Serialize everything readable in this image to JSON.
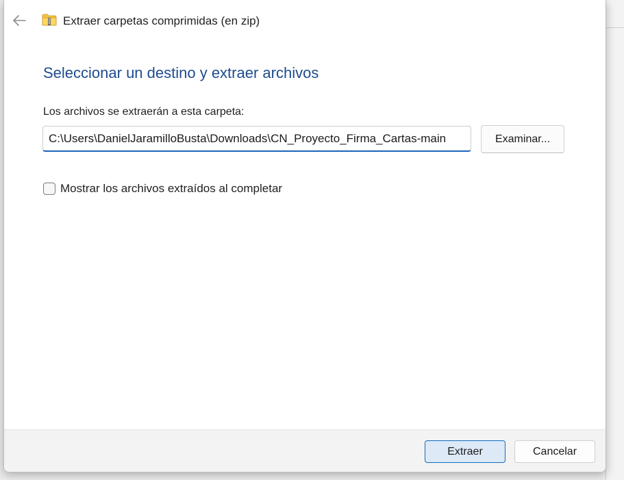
{
  "window": {
    "title": "Extraer carpetas comprimidas (en zip)",
    "back_icon": "arrow-left-icon",
    "app_icon": "zip-folder-icon"
  },
  "main": {
    "heading": "Seleccionar un destino y extraer archivos",
    "destination_label": "Los archivos se extraerán a esta carpeta:",
    "destination_path": "C:\\Users\\DanielJaramilloBusta\\Downloads\\CN_Proyecto_Firma_Cartas-main",
    "browse_label": "Examinar...",
    "show_files_label": "Mostrar los archivos extraídos al completar",
    "show_files_checked": false
  },
  "footer": {
    "extract_label": "Extraer",
    "cancel_label": "Cancelar"
  },
  "colors": {
    "heading": "#1e4b8f",
    "accent": "#0f6cbd",
    "primary_button_bg": "#dde9f7"
  }
}
